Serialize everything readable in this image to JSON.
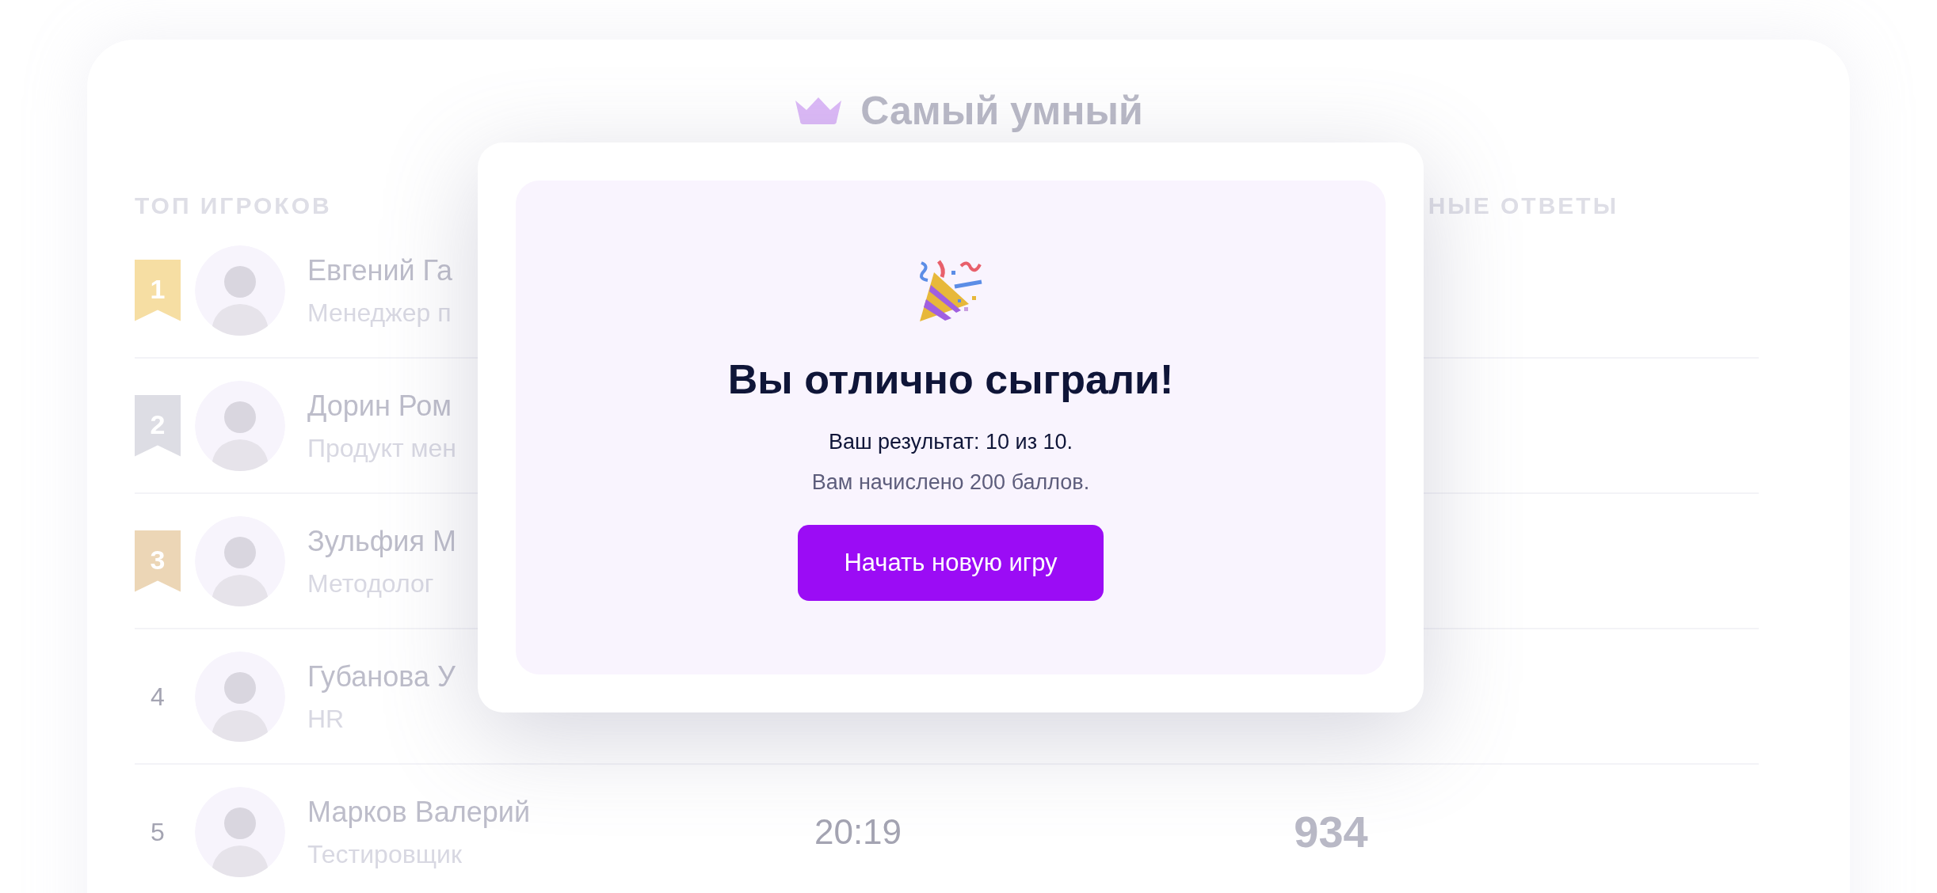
{
  "title": "Самый умный",
  "table": {
    "columns": [
      "ТОП ИГРОКОВ",
      "НЫЕ ОТВЕТЫ"
    ],
    "rows": [
      {
        "kind": "medal",
        "rank": "1",
        "color": "#f6dea3",
        "name": "Евгений Га",
        "role": "Менеджер п"
      },
      {
        "kind": "medal",
        "rank": "2",
        "color": "#dddde4",
        "name": "Дорин Ром",
        "role": "Продукт мен"
      },
      {
        "kind": "medal",
        "rank": "3",
        "color": "#ecd6b6",
        "name": "Зульфия М",
        "role": "Методолог"
      },
      {
        "kind": "plain",
        "rank": "4",
        "name": "Губанова У",
        "role": "HR"
      },
      {
        "kind": "plain",
        "rank": "5",
        "name": "Марков Валерий",
        "role": "Тестировщик",
        "time": "20:19",
        "score": "934"
      }
    ]
  },
  "modal": {
    "heading": "Вы отлично сыграли!",
    "result": "Ваш результат: 10 из 10.",
    "points": "Вам начислено 200 баллов.",
    "button": "Начать новую игру"
  }
}
